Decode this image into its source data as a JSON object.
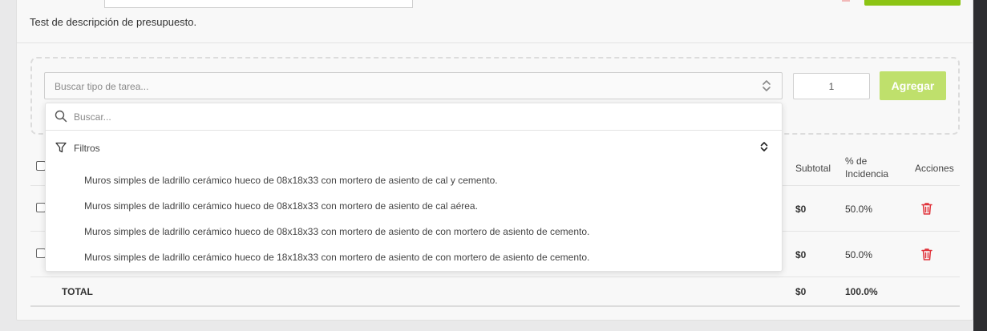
{
  "budget": {
    "description": "Test de descripción de presupuesto."
  },
  "task_picker": {
    "placeholder": "Buscar tipo de tarea...",
    "quantity": "1",
    "add_label": "Agregar",
    "dropdown": {
      "search_placeholder": "Buscar...",
      "filters_label": "Filtros",
      "options": [
        "Muros simples de ladrillo cerámico hueco de 08x18x33 con mortero de asiento de cal y cemento.",
        "Muros simples de ladrillo cerámico hueco de 08x18x33 con mortero de asiento de cal aérea.",
        "Muros simples de ladrillo cerámico hueco de 08x18x33 con mortero de asiento de con mortero de asiento de cemento.",
        "Muros simples de ladrillo cerámico hueco de 18x18x33 con mortero de asiento de con mortero de asiento de cemento."
      ]
    }
  },
  "table": {
    "headers": {
      "subtotal": "Subtotal",
      "incidence_1": "% de",
      "incidence_2": "Incidencia",
      "actions": "Acciones"
    },
    "rows": [
      {
        "subtotal": "$0",
        "incidence": "50.0%"
      },
      {
        "subtotal": "$0",
        "incidence": "50.0%"
      }
    ],
    "total": {
      "label": "TOTAL",
      "subtotal": "$0",
      "incidence": "100.0%"
    }
  },
  "colors": {
    "accent_green": "#8cc414",
    "add_button_disabled": "#bfe06c",
    "delete_red": "#e0323a"
  },
  "icons": [
    "search-icon",
    "filter-icon",
    "chevron-updown-icon",
    "trash-icon"
  ]
}
